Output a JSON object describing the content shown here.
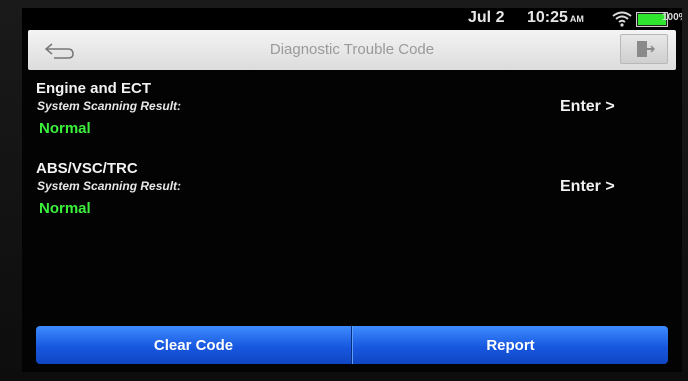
{
  "status_bar": {
    "date": "Jul 2",
    "time": "10:25",
    "ampm": "AM",
    "battery": "100%",
    "battery_level": 1.0
  },
  "header": {
    "title": "Diagnostic Trouble Code",
    "back_icon": "back-arrow-icon",
    "exit_icon": "exit-door-icon"
  },
  "systems": [
    {
      "name": "Engine and ECT",
      "caption": "System Scanning Result:",
      "status": "Normal",
      "enter_label": "Enter >"
    },
    {
      "name": "ABS/VSC/TRC",
      "caption": "System Scanning Result:",
      "status": "Normal",
      "enter_label": "Enter >"
    }
  ],
  "footer": {
    "clear_label": "Clear Code",
    "report_label": "Report"
  },
  "colors": {
    "status_normal": "#3cf03c",
    "button_blue": "#1758e0",
    "screen_bg": "#030303"
  }
}
